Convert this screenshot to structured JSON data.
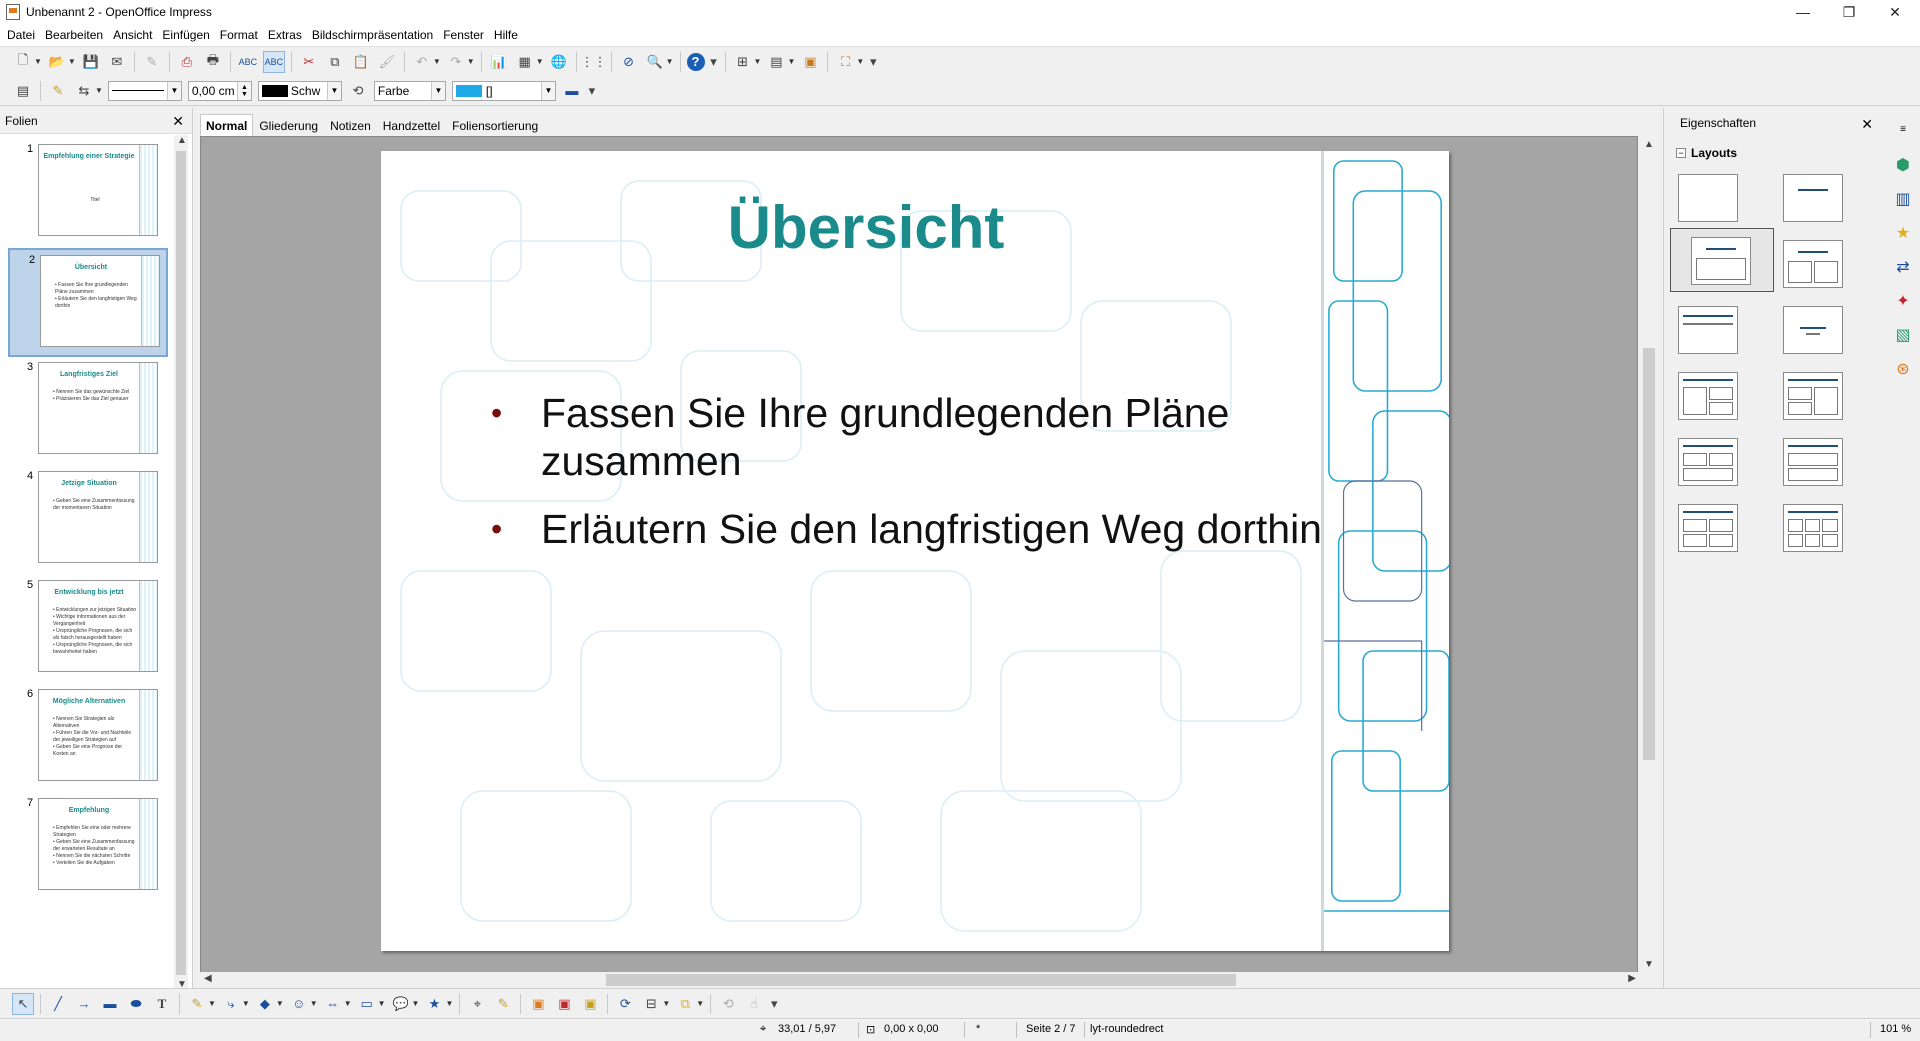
{
  "window": {
    "title": "Unbenannt 2 - OpenOffice Impress",
    "minimize": "—",
    "maximize": "❐",
    "close": "✕"
  },
  "menu": [
    "Datei",
    "Bearbeiten",
    "Ansicht",
    "Einfügen",
    "Format",
    "Extras",
    "Bildschirmpräsentation",
    "Fenster",
    "Hilfe"
  ],
  "toolbar2": {
    "line_width": "0,00 cm",
    "line_color": "Schw",
    "area_mode": "Farbe",
    "area_color_value": "[]",
    "line_color_hex": "#000000",
    "area_color_hex": "#1ea9e8"
  },
  "slides_panel": {
    "title": "Folien",
    "close": "✕",
    "slides": [
      {
        "num": "1",
        "title": "Empfehlung einer Strategie",
        "body": [
          "Titel"
        ]
      },
      {
        "num": "2",
        "title": "Übersicht",
        "body": [
          "• Fassen Sie Ihre grundlegenden Pläne zusammen",
          "• Erläutern Sie den langfristigen Weg dorthin"
        ]
      },
      {
        "num": "3",
        "title": "Langfristiges Ziel",
        "body": [
          "• Nennen Sie das gewünschte Ziel",
          "• Präzisieren Sie das Ziel genauer"
        ]
      },
      {
        "num": "4",
        "title": "Jetzige Situation",
        "body": [
          "• Geben Sie eine Zusammenfassung der momentanen Situation"
        ]
      },
      {
        "num": "5",
        "title": "Entwicklung bis jetzt",
        "body": [
          "• Entwicklungen zur jetzigen Situation",
          "• Wichtige Informationen aus der Vergangenheit",
          "• Ursprüngliche Prognosen, die sich als falsch herausgestellt haben",
          "• Ursprüngliche Prognosen, die sich bewahrheitet haben"
        ]
      },
      {
        "num": "6",
        "title": "Mögliche Alternativen",
        "body": [
          "• Nennen Sie Strategien als Alternativen",
          "• Führen Sie die Vor- und Nachteile der jeweiligen Strategien auf",
          "• Geben Sie eine Prognose der Kosten an"
        ]
      },
      {
        "num": "7",
        "title": "Empfehlung",
        "body": [
          "• Empfehlen Sie eine oder mehrere Strategien",
          "• Geben Sie eine Zusammenfassung der erwarteten Resultate an",
          "• Nennen Sie die nächsten Schritte",
          "• Verteilen Sie die Aufgaben"
        ]
      }
    ]
  },
  "tabs": [
    "Normal",
    "Gliederung",
    "Notizen",
    "Handzettel",
    "Foliensortierung"
  ],
  "current_slide": {
    "title": "Übersicht",
    "bullets": [
      "Fassen Sie Ihre grundlegenden Pläne zusammen",
      "Erläutern Sie den langfristigen Weg dorthin"
    ],
    "title_color": "#1a8a8a",
    "bullet_color": "#7a0c0c"
  },
  "properties": {
    "title": "Eigenschaften",
    "close": "✕",
    "section": "Layouts",
    "section_toggle": "−"
  },
  "status": {
    "position": "33,01 / 5,97",
    "size": "0,00 x 0,00",
    "modified": "*",
    "page": "Seite 2 / 7",
    "master": "lyt-roundedrect",
    "zoom": "101 %"
  }
}
